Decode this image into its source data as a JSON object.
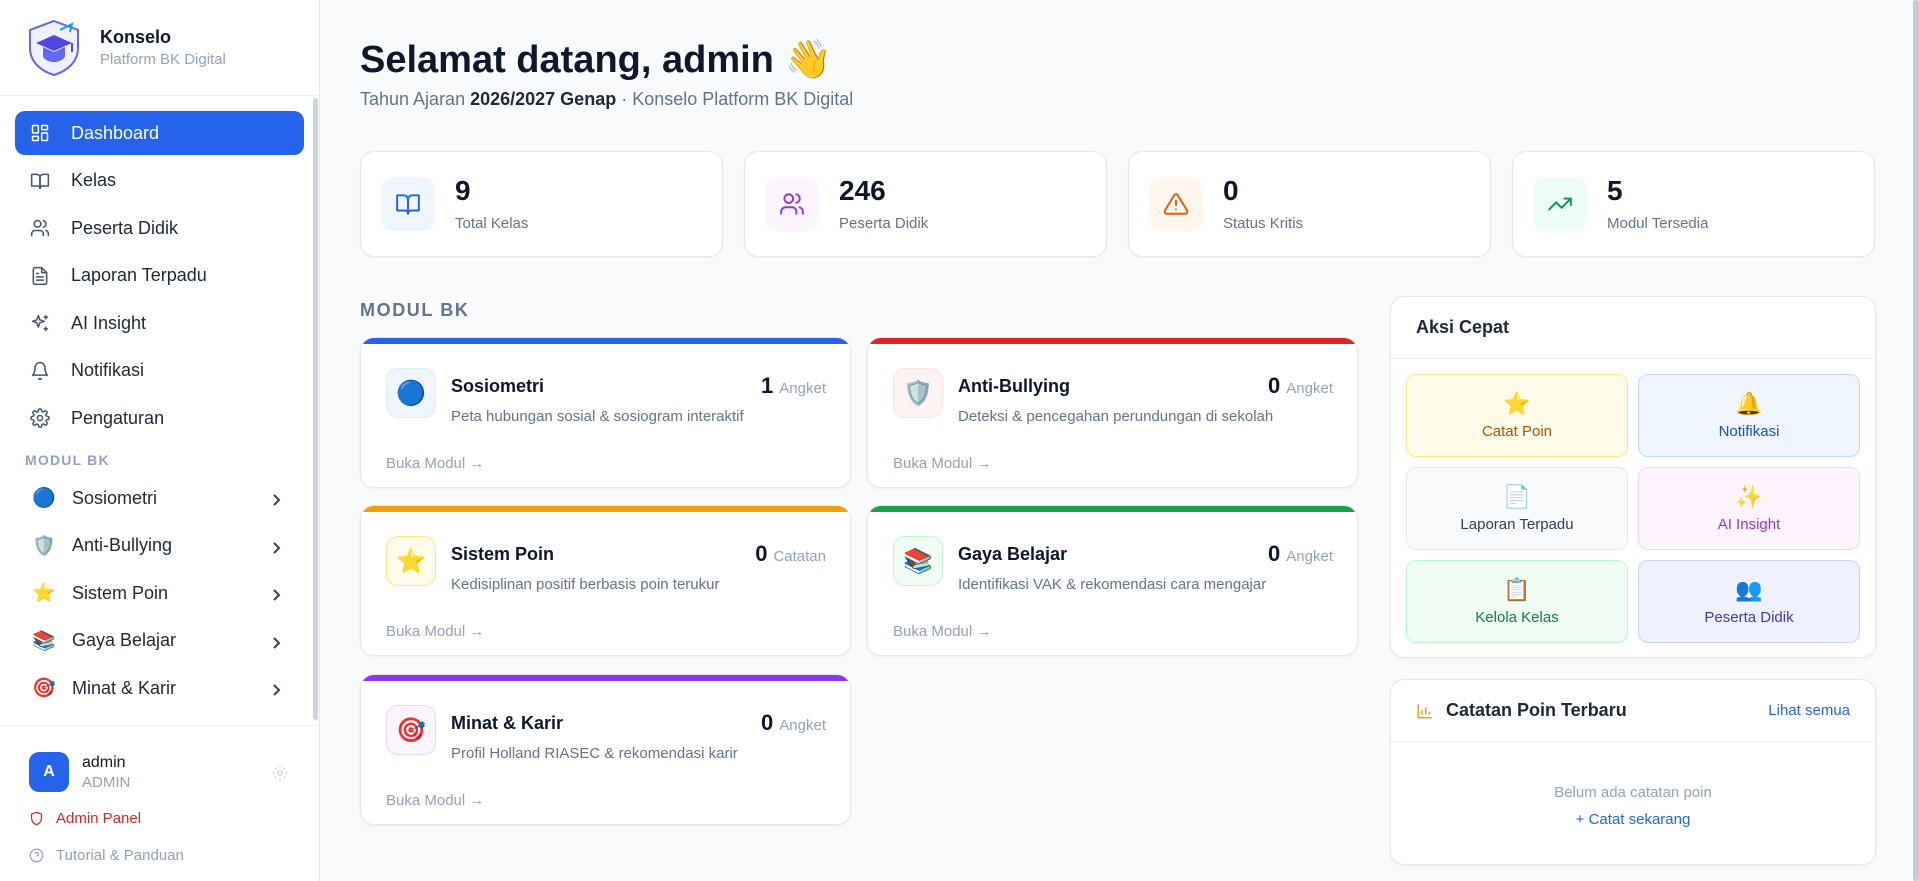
{
  "brand": {
    "name": "Konselo",
    "subtitle": "Platform BK Digital"
  },
  "nav": [
    {
      "label": "Dashboard",
      "icon": "dashboard-icon",
      "active": true
    },
    {
      "label": "Kelas",
      "icon": "book-icon"
    },
    {
      "label": "Peserta Didik",
      "icon": "users-icon"
    },
    {
      "label": "Laporan Terpadu",
      "icon": "document-icon"
    },
    {
      "label": "AI Insight",
      "icon": "sparkles-icon"
    },
    {
      "label": "Notifikasi",
      "icon": "bell-icon"
    },
    {
      "label": "Pengaturan",
      "icon": "gear-icon"
    }
  ],
  "sidebar_section_label": "MODUL BK",
  "sidebar_modules": [
    {
      "label": "Sosiometri",
      "emoji": "🔵"
    },
    {
      "label": "Anti-Bullying",
      "emoji": "🛡️"
    },
    {
      "label": "Sistem Poin",
      "emoji": "⭐"
    },
    {
      "label": "Gaya Belajar",
      "emoji": "📚"
    },
    {
      "label": "Minat & Karir",
      "emoji": "🎯"
    }
  ],
  "user": {
    "initial": "A",
    "name": "admin",
    "role": "ADMIN",
    "admin_panel": "Admin Panel",
    "tutorial": "Tutorial & Panduan"
  },
  "header": {
    "welcome": "Selamat datang, admin",
    "wave": "👋",
    "year_prefix": "Tahun Ajaran ",
    "year": "2026/2027 Genap",
    "year_suffix": " · Konselo Platform BK Digital"
  },
  "stats": [
    {
      "value": "9",
      "label": "Total Kelas",
      "icon": "book-icon",
      "bg": "#eff6ff",
      "color": "#2563eb"
    },
    {
      "value": "246",
      "label": "Peserta Didik",
      "icon": "users-icon",
      "bg": "#faf5ff",
      "color": "#9333ea"
    },
    {
      "value": "0",
      "label": "Status Kritis",
      "icon": "warning-icon",
      "bg": "#fff7ed",
      "color": "#ea580c"
    },
    {
      "value": "5",
      "label": "Modul Tersedia",
      "icon": "trending-up-icon",
      "bg": "#ecfdf5",
      "color": "#059669"
    }
  ],
  "modul_section_label": "MODUL BK",
  "modules": [
    {
      "title": "Sosiometri",
      "desc": "Peta hubungan sosial & sosiogram interaktif",
      "count": "1",
      "unit": "Angket",
      "emoji": "🔵",
      "bar": "#2563eb",
      "ico_bg": "#eff6ff",
      "ico_border": "#dbeafe",
      "open": "Buka Modul →"
    },
    {
      "title": "Anti-Bullying",
      "desc": "Deteksi & pencegahan perundungan di sekolah",
      "count": "0",
      "unit": "Angket",
      "emoji": "🛡️",
      "bar": "#dc2626",
      "ico_bg": "#fef2f2",
      "ico_border": "#fee2e2",
      "open": "Buka Modul →"
    },
    {
      "title": "Sistem Poin",
      "desc": "Kedisiplinan positif berbasis poin terukur",
      "count": "0",
      "unit": "Catatan",
      "emoji": "⭐",
      "bar": "#f59e0b",
      "ico_bg": "#fffbeb",
      "ico_border": "#fde68a",
      "open": "Buka Modul →"
    },
    {
      "title": "Gaya Belajar",
      "desc": "Identifikasi VAK & rekomendasi cara mengajar",
      "count": "0",
      "unit": "Angket",
      "emoji": "📚",
      "bar": "#16a34a",
      "ico_bg": "#f0fdf4",
      "ico_border": "#bbf7d0",
      "open": "Buka Modul →"
    },
    {
      "title": "Minat & Karir",
      "desc": "Profil Holland RIASEC & rekomendasi karir",
      "count": "0",
      "unit": "Angket",
      "emoji": "🎯",
      "bar": "#9333ea",
      "ico_bg": "#faf5ff",
      "ico_border": "#e9d5ff",
      "open": "Buka Modul →"
    }
  ],
  "quick_actions": {
    "title": "Aksi Cepat",
    "items": [
      {
        "label": "Catat Poin",
        "emoji": "⭐",
        "bg": "#fefce8",
        "border": "#fde68a",
        "color": "#b45309"
      },
      {
        "label": "Notifikasi",
        "emoji": "🔔",
        "bg": "#eff6ff",
        "border": "#bfdbfe",
        "color": "#1d4ed8"
      },
      {
        "label": "Laporan Terpadu",
        "emoji": "📄",
        "bg": "#f8fafc",
        "border": "#e2e8f0",
        "color": "#334155"
      },
      {
        "label": "AI Insight",
        "emoji": "✨",
        "bg": "#fdf4ff",
        "border": "#f0abfc",
        "color": "#9333ea"
      },
      {
        "label": "Kelola Kelas",
        "emoji": "📋",
        "bg": "#f0fdf4",
        "border": "#bbf7d0",
        "color": "#15803d"
      },
      {
        "label": "Peserta Didik",
        "emoji": "👥",
        "bg": "#eef2ff",
        "border": "#c7d2fe",
        "color": "#4338ca"
      }
    ]
  },
  "poin_panel": {
    "title": "Catatan Poin Terbaru",
    "link": "Lihat semua",
    "empty": "Belum ada catatan poin",
    "cta": "+ Catat sekarang"
  }
}
